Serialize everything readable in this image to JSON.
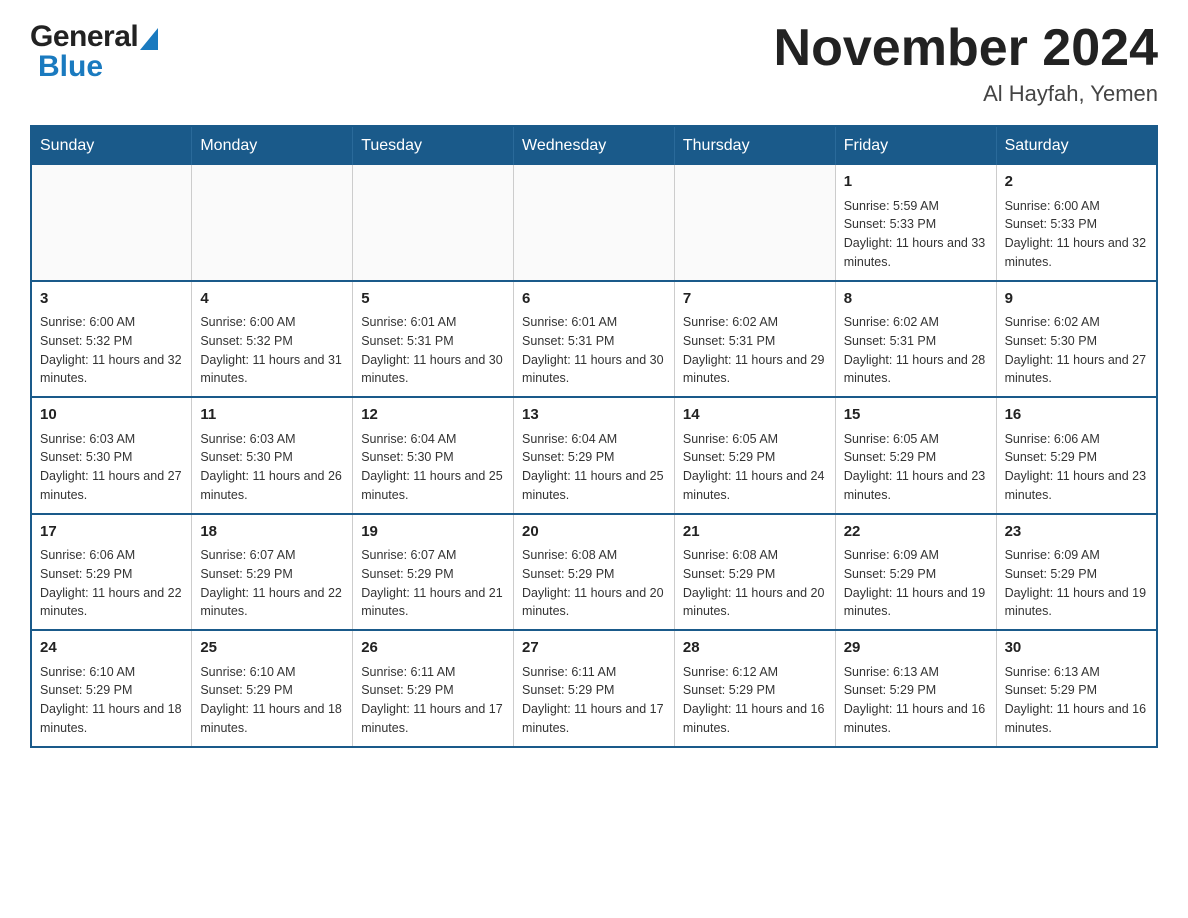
{
  "header": {
    "logo_general": "General",
    "logo_blue": "Blue",
    "month_year": "November 2024",
    "location": "Al Hayfah, Yemen"
  },
  "days_of_week": [
    "Sunday",
    "Monday",
    "Tuesday",
    "Wednesday",
    "Thursday",
    "Friday",
    "Saturday"
  ],
  "weeks": [
    [
      {
        "day": "",
        "info": ""
      },
      {
        "day": "",
        "info": ""
      },
      {
        "day": "",
        "info": ""
      },
      {
        "day": "",
        "info": ""
      },
      {
        "day": "",
        "info": ""
      },
      {
        "day": "1",
        "info": "Sunrise: 5:59 AM\nSunset: 5:33 PM\nDaylight: 11 hours and 33 minutes."
      },
      {
        "day": "2",
        "info": "Sunrise: 6:00 AM\nSunset: 5:33 PM\nDaylight: 11 hours and 32 minutes."
      }
    ],
    [
      {
        "day": "3",
        "info": "Sunrise: 6:00 AM\nSunset: 5:32 PM\nDaylight: 11 hours and 32 minutes."
      },
      {
        "day": "4",
        "info": "Sunrise: 6:00 AM\nSunset: 5:32 PM\nDaylight: 11 hours and 31 minutes."
      },
      {
        "day": "5",
        "info": "Sunrise: 6:01 AM\nSunset: 5:31 PM\nDaylight: 11 hours and 30 minutes."
      },
      {
        "day": "6",
        "info": "Sunrise: 6:01 AM\nSunset: 5:31 PM\nDaylight: 11 hours and 30 minutes."
      },
      {
        "day": "7",
        "info": "Sunrise: 6:02 AM\nSunset: 5:31 PM\nDaylight: 11 hours and 29 minutes."
      },
      {
        "day": "8",
        "info": "Sunrise: 6:02 AM\nSunset: 5:31 PM\nDaylight: 11 hours and 28 minutes."
      },
      {
        "day": "9",
        "info": "Sunrise: 6:02 AM\nSunset: 5:30 PM\nDaylight: 11 hours and 27 minutes."
      }
    ],
    [
      {
        "day": "10",
        "info": "Sunrise: 6:03 AM\nSunset: 5:30 PM\nDaylight: 11 hours and 27 minutes."
      },
      {
        "day": "11",
        "info": "Sunrise: 6:03 AM\nSunset: 5:30 PM\nDaylight: 11 hours and 26 minutes."
      },
      {
        "day": "12",
        "info": "Sunrise: 6:04 AM\nSunset: 5:30 PM\nDaylight: 11 hours and 25 minutes."
      },
      {
        "day": "13",
        "info": "Sunrise: 6:04 AM\nSunset: 5:29 PM\nDaylight: 11 hours and 25 minutes."
      },
      {
        "day": "14",
        "info": "Sunrise: 6:05 AM\nSunset: 5:29 PM\nDaylight: 11 hours and 24 minutes."
      },
      {
        "day": "15",
        "info": "Sunrise: 6:05 AM\nSunset: 5:29 PM\nDaylight: 11 hours and 23 minutes."
      },
      {
        "day": "16",
        "info": "Sunrise: 6:06 AM\nSunset: 5:29 PM\nDaylight: 11 hours and 23 minutes."
      }
    ],
    [
      {
        "day": "17",
        "info": "Sunrise: 6:06 AM\nSunset: 5:29 PM\nDaylight: 11 hours and 22 minutes."
      },
      {
        "day": "18",
        "info": "Sunrise: 6:07 AM\nSunset: 5:29 PM\nDaylight: 11 hours and 22 minutes."
      },
      {
        "day": "19",
        "info": "Sunrise: 6:07 AM\nSunset: 5:29 PM\nDaylight: 11 hours and 21 minutes."
      },
      {
        "day": "20",
        "info": "Sunrise: 6:08 AM\nSunset: 5:29 PM\nDaylight: 11 hours and 20 minutes."
      },
      {
        "day": "21",
        "info": "Sunrise: 6:08 AM\nSunset: 5:29 PM\nDaylight: 11 hours and 20 minutes."
      },
      {
        "day": "22",
        "info": "Sunrise: 6:09 AM\nSunset: 5:29 PM\nDaylight: 11 hours and 19 minutes."
      },
      {
        "day": "23",
        "info": "Sunrise: 6:09 AM\nSunset: 5:29 PM\nDaylight: 11 hours and 19 minutes."
      }
    ],
    [
      {
        "day": "24",
        "info": "Sunrise: 6:10 AM\nSunset: 5:29 PM\nDaylight: 11 hours and 18 minutes."
      },
      {
        "day": "25",
        "info": "Sunrise: 6:10 AM\nSunset: 5:29 PM\nDaylight: 11 hours and 18 minutes."
      },
      {
        "day": "26",
        "info": "Sunrise: 6:11 AM\nSunset: 5:29 PM\nDaylight: 11 hours and 17 minutes."
      },
      {
        "day": "27",
        "info": "Sunrise: 6:11 AM\nSunset: 5:29 PM\nDaylight: 11 hours and 17 minutes."
      },
      {
        "day": "28",
        "info": "Sunrise: 6:12 AM\nSunset: 5:29 PM\nDaylight: 11 hours and 16 minutes."
      },
      {
        "day": "29",
        "info": "Sunrise: 6:13 AM\nSunset: 5:29 PM\nDaylight: 11 hours and 16 minutes."
      },
      {
        "day": "30",
        "info": "Sunrise: 6:13 AM\nSunset: 5:29 PM\nDaylight: 11 hours and 16 minutes."
      }
    ]
  ]
}
